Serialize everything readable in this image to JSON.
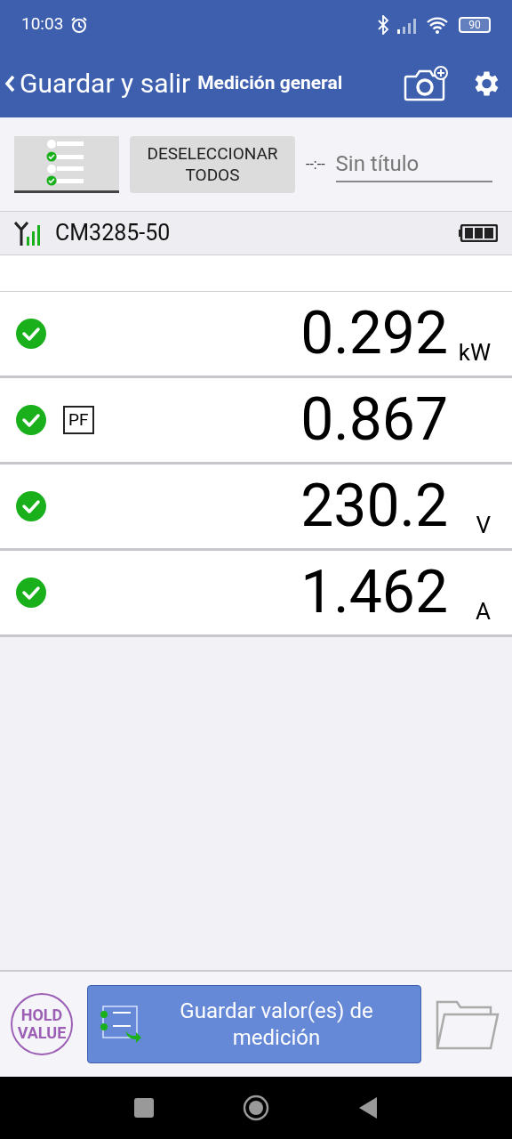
{
  "status_bar": {
    "time": "10:03",
    "battery": "90"
  },
  "header": {
    "back_label": "Guardar y salir",
    "title": "Medición general"
  },
  "toolbar": {
    "list_toggle_active": true,
    "deselect_label": "DESELECCIONAR TODOS",
    "time_marker": "--:--",
    "title_field": {
      "placeholder": "Sin título"
    }
  },
  "device": {
    "name": "CM3285-50"
  },
  "readings": [
    {
      "checked": true,
      "value": "0.292",
      "unit": "kW"
    },
    {
      "checked": true,
      "badge": "PF",
      "value": "0.867"
    },
    {
      "checked": true,
      "value": "230.2",
      "unit": "V"
    },
    {
      "checked": true,
      "value": "1.462",
      "unit": "A"
    }
  ],
  "footer": {
    "hold_label": "HOLD VALUE",
    "save_label": "Guardar valor(es) de medición"
  }
}
